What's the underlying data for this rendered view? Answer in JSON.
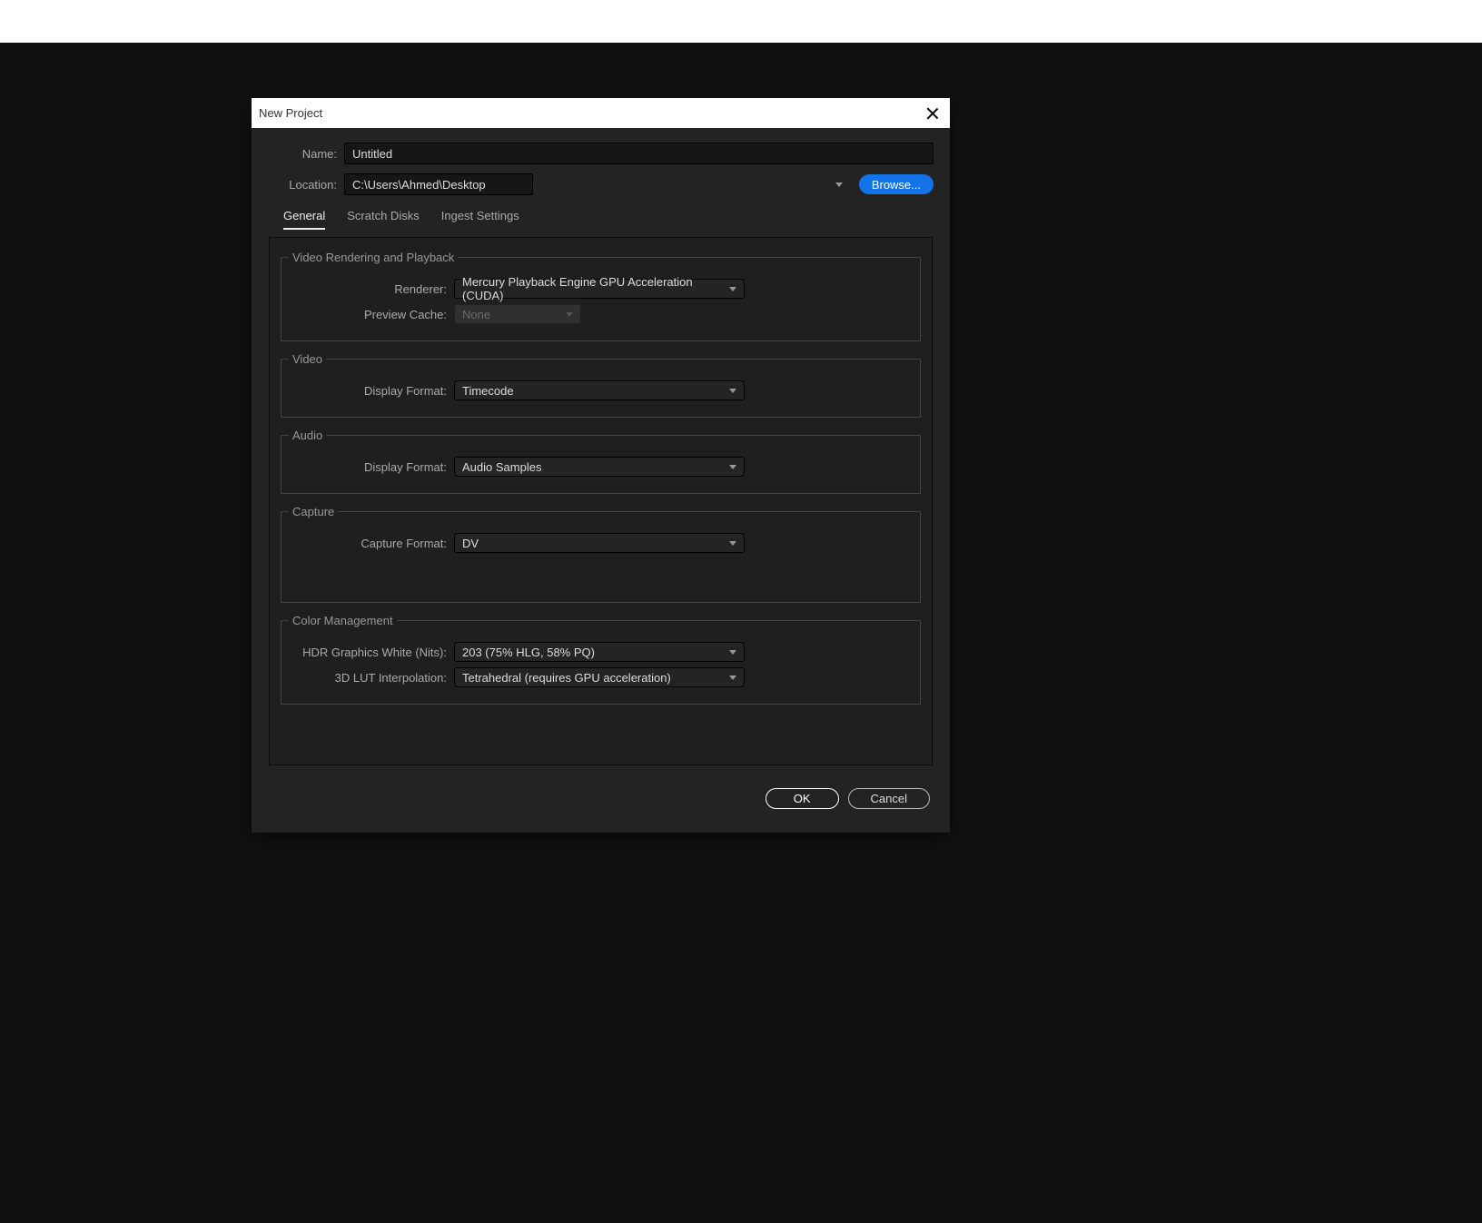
{
  "dialog": {
    "title": "New Project"
  },
  "form": {
    "name_label": "Name:",
    "name_value": "Untitled",
    "location_label": "Location:",
    "location_value": "C:\\Users\\Ahmed\\Desktop",
    "browse_label": "Browse..."
  },
  "tabs": {
    "general": "General",
    "scratch_disks": "Scratch Disks",
    "ingest_settings": "Ingest Settings"
  },
  "groups": {
    "rendering": {
      "legend": "Video Rendering and Playback",
      "renderer_label": "Renderer:",
      "renderer_value": "Mercury Playback Engine GPU Acceleration (CUDA)",
      "preview_cache_label": "Preview Cache:",
      "preview_cache_value": "None"
    },
    "video": {
      "legend": "Video",
      "display_format_label": "Display Format:",
      "display_format_value": "Timecode"
    },
    "audio": {
      "legend": "Audio",
      "display_format_label": "Display Format:",
      "display_format_value": "Audio Samples"
    },
    "capture": {
      "legend": "Capture",
      "capture_format_label": "Capture Format:",
      "capture_format_value": "DV"
    },
    "color": {
      "legend": "Color Management",
      "hdr_label": "HDR Graphics White (Nits):",
      "hdr_value": "203 (75% HLG, 58% PQ)",
      "lut_label": "3D LUT Interpolation:",
      "lut_value": "Tetrahedral (requires GPU acceleration)"
    }
  },
  "buttons": {
    "ok": "OK",
    "cancel": "Cancel"
  }
}
